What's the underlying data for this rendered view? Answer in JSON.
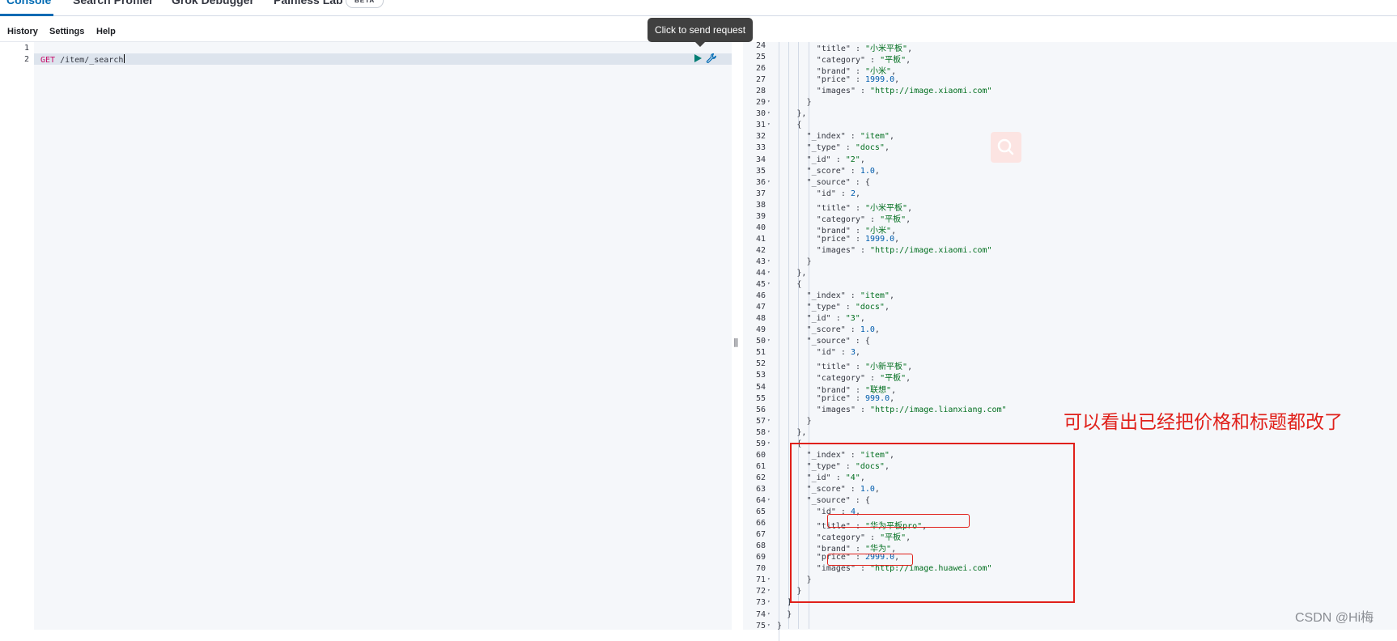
{
  "tabs": [
    "Console",
    "Search Profiler",
    "Grok Debugger",
    "Painless Lab"
  ],
  "beta_badge": "BETA",
  "menu": [
    "History",
    "Settings",
    "Help"
  ],
  "tooltip": "Click to send request",
  "request": {
    "line_numbers": [
      "1",
      "2"
    ],
    "method": "GET",
    "path": "/item/_search"
  },
  "resizer": "‖",
  "response_lines": [
    {
      "n": "24",
      "fold": false,
      "depth": 4,
      "t": "\"title\" : \"小米平板\","
    },
    {
      "n": "25",
      "fold": false,
      "depth": 4,
      "t": "\"category\" : \"平板\","
    },
    {
      "n": "26",
      "fold": false,
      "depth": 4,
      "t": "\"brand\" : \"小米\","
    },
    {
      "n": "27",
      "fold": false,
      "depth": 4,
      "t": "\"price\" : 1999.0,"
    },
    {
      "n": "28",
      "fold": false,
      "depth": 4,
      "t": "\"images\" : \"http://image.xiaomi.com\""
    },
    {
      "n": "29",
      "fold": true,
      "depth": 3,
      "t": "}"
    },
    {
      "n": "30",
      "fold": true,
      "depth": 2,
      "t": "},"
    },
    {
      "n": "31",
      "fold": true,
      "depth": 2,
      "t": "{"
    },
    {
      "n": "32",
      "fold": false,
      "depth": 3,
      "t": "\"_index\" : \"item\","
    },
    {
      "n": "33",
      "fold": false,
      "depth": 3,
      "t": "\"_type\" : \"docs\","
    },
    {
      "n": "34",
      "fold": false,
      "depth": 3,
      "t": "\"_id\" : \"2\","
    },
    {
      "n": "35",
      "fold": false,
      "depth": 3,
      "t": "\"_score\" : 1.0,"
    },
    {
      "n": "36",
      "fold": true,
      "depth": 3,
      "t": "\"_source\" : {"
    },
    {
      "n": "37",
      "fold": false,
      "depth": 4,
      "t": "\"id\" : 2,"
    },
    {
      "n": "38",
      "fold": false,
      "depth": 4,
      "t": "\"title\" : \"小米平板\","
    },
    {
      "n": "39",
      "fold": false,
      "depth": 4,
      "t": "\"category\" : \"平板\","
    },
    {
      "n": "40",
      "fold": false,
      "depth": 4,
      "t": "\"brand\" : \"小米\","
    },
    {
      "n": "41",
      "fold": false,
      "depth": 4,
      "t": "\"price\" : 1999.0,"
    },
    {
      "n": "42",
      "fold": false,
      "depth": 4,
      "t": "\"images\" : \"http://image.xiaomi.com\""
    },
    {
      "n": "43",
      "fold": true,
      "depth": 3,
      "t": "}"
    },
    {
      "n": "44",
      "fold": true,
      "depth": 2,
      "t": "},"
    },
    {
      "n": "45",
      "fold": true,
      "depth": 2,
      "t": "{"
    },
    {
      "n": "46",
      "fold": false,
      "depth": 3,
      "t": "\"_index\" : \"item\","
    },
    {
      "n": "47",
      "fold": false,
      "depth": 3,
      "t": "\"_type\" : \"docs\","
    },
    {
      "n": "48",
      "fold": false,
      "depth": 3,
      "t": "\"_id\" : \"3\","
    },
    {
      "n": "49",
      "fold": false,
      "depth": 3,
      "t": "\"_score\" : 1.0,"
    },
    {
      "n": "50",
      "fold": true,
      "depth": 3,
      "t": "\"_source\" : {"
    },
    {
      "n": "51",
      "fold": false,
      "depth": 4,
      "t": "\"id\" : 3,"
    },
    {
      "n": "52",
      "fold": false,
      "depth": 4,
      "t": "\"title\" : \"小新平板\","
    },
    {
      "n": "53",
      "fold": false,
      "depth": 4,
      "t": "\"category\" : \"平板\","
    },
    {
      "n": "54",
      "fold": false,
      "depth": 4,
      "t": "\"brand\" : \"联想\","
    },
    {
      "n": "55",
      "fold": false,
      "depth": 4,
      "t": "\"price\" : 999.0,"
    },
    {
      "n": "56",
      "fold": false,
      "depth": 4,
      "t": "\"images\" : \"http://image.lianxiang.com\""
    },
    {
      "n": "57",
      "fold": true,
      "depth": 3,
      "t": "}"
    },
    {
      "n": "58",
      "fold": true,
      "depth": 2,
      "t": "},"
    },
    {
      "n": "59",
      "fold": true,
      "depth": 2,
      "t": "{"
    },
    {
      "n": "60",
      "fold": false,
      "depth": 3,
      "t": "\"_index\" : \"item\","
    },
    {
      "n": "61",
      "fold": false,
      "depth": 3,
      "t": "\"_type\" : \"docs\","
    },
    {
      "n": "62",
      "fold": false,
      "depth": 3,
      "t": "\"_id\" : \"4\","
    },
    {
      "n": "63",
      "fold": false,
      "depth": 3,
      "t": "\"_score\" : 1.0,"
    },
    {
      "n": "64",
      "fold": true,
      "depth": 3,
      "t": "\"_source\" : {"
    },
    {
      "n": "65",
      "fold": false,
      "depth": 4,
      "t": "\"id\" : 4,"
    },
    {
      "n": "66",
      "fold": false,
      "depth": 4,
      "t": "\"title\" : \"华为平板pro\","
    },
    {
      "n": "67",
      "fold": false,
      "depth": 4,
      "t": "\"category\" : \"平板\","
    },
    {
      "n": "68",
      "fold": false,
      "depth": 4,
      "t": "\"brand\" : \"华为\","
    },
    {
      "n": "69",
      "fold": false,
      "depth": 4,
      "t": "\"price\" : 2999.0,"
    },
    {
      "n": "70",
      "fold": false,
      "depth": 4,
      "t": "\"images\" : \"http://image.huawei.com\""
    },
    {
      "n": "71",
      "fold": true,
      "depth": 3,
      "t": "}"
    },
    {
      "n": "72",
      "fold": true,
      "depth": 2,
      "t": "}"
    },
    {
      "n": "73",
      "fold": true,
      "depth": 1,
      "t": "]"
    },
    {
      "n": "74",
      "fold": true,
      "depth": 1,
      "t": "}"
    },
    {
      "n": "75",
      "fold": true,
      "depth": 0,
      "t": "}"
    }
  ],
  "annotation": "可以看出已经把价格和标题都改了",
  "watermark": "CSDN @Hi梅",
  "colors": {
    "accent": "#006bb4",
    "string": "#006e1e",
    "number": "#005cac",
    "method": "#c80a68",
    "annotation": "#e0201a"
  },
  "icons": [
    "play-icon",
    "wrench-icon",
    "search-icon",
    "fold-arrow-icon"
  ]
}
